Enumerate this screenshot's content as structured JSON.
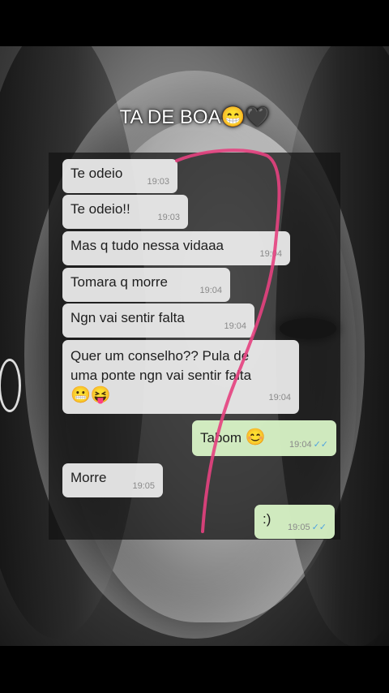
{
  "title": {
    "text": "TA DE BOA",
    "emoji": "😁🖤"
  },
  "messages": [
    {
      "text": "Te odeio",
      "time": "19:03",
      "dir": "in"
    },
    {
      "text": "Te odeio!!",
      "time": "19:03",
      "dir": "in"
    },
    {
      "text": "Mas q tudo nessa vidaaa",
      "time": "19:04",
      "dir": "in"
    },
    {
      "text": "Tomara q morre",
      "time": "19:04",
      "dir": "in"
    },
    {
      "text": "Ngn vai sentir falta",
      "time": "19:04",
      "dir": "in"
    },
    {
      "line1": "Quer um conselho?? Pula de",
      "line2": "uma ponte ngn vai sentir falta",
      "emoji": "😬😝",
      "time": "19:04",
      "dir": "in"
    },
    {
      "text": "Tabom",
      "emoji": "😊",
      "time": "19:04",
      "dir": "out"
    },
    {
      "text": "Morre",
      "time": "19:05",
      "dir": "in"
    },
    {
      "text": ":)",
      "time": "19:05",
      "dir": "out"
    }
  ],
  "read_ticks": "✓✓",
  "colors": {
    "incoming_bubble": "#eeeeee",
    "outgoing_bubble": "#daf5c8",
    "ticks": "#4fa3e0",
    "line": "#e5417f"
  }
}
